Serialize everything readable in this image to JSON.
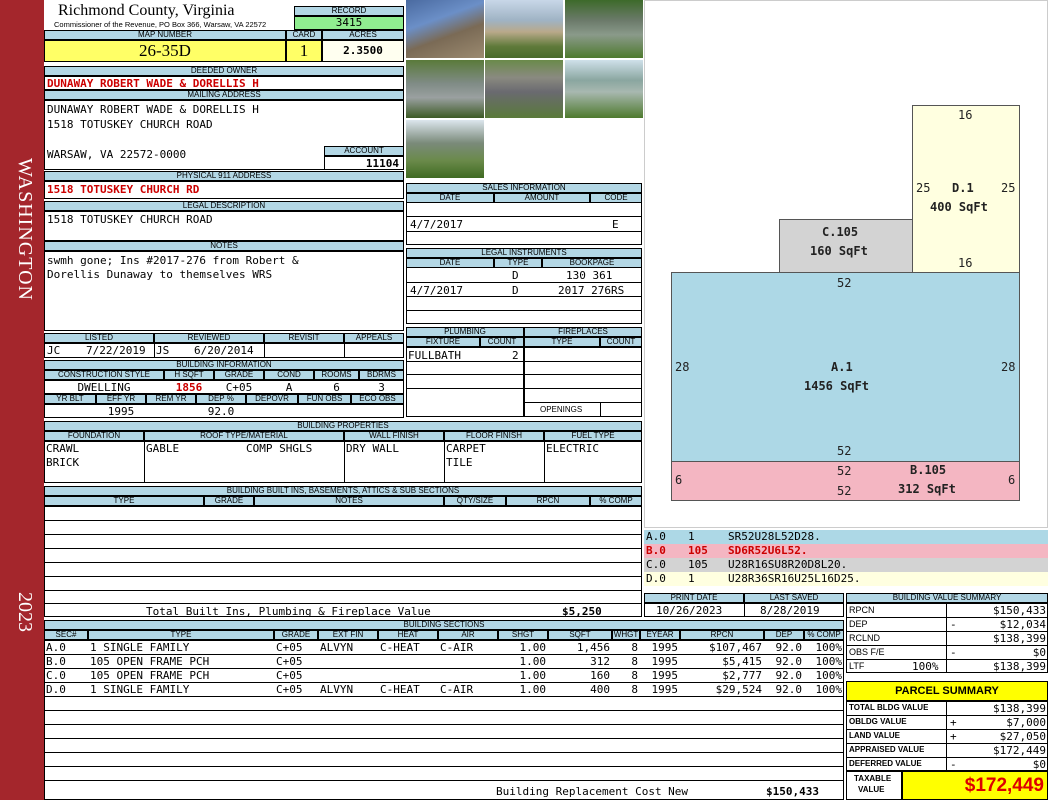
{
  "sidebar": {
    "top_text": "WASHINGTON",
    "bottom_text": "2023",
    "color": "#a4262c"
  },
  "header": {
    "county": "Richmond County, Virginia",
    "commissioner": "Commissioner of the Revenue, PO Box 366, Warsaw, VA 22572",
    "record_label": "RECORD",
    "record": "3415",
    "map_label": "MAP NUMBER",
    "map": "26-35D",
    "card_label": "CARD",
    "card": "1",
    "acres_label": "ACRES",
    "acres": "2.3500"
  },
  "owner": {
    "label": "DEEDED OWNER",
    "name": "DUNAWAY ROBERT WADE & DORELLIS H",
    "mailing_label": "MAILING ADDRESS",
    "mail1": "DUNAWAY ROBERT WADE & DORELLIS H",
    "mail2": "1518 TOTUSKEY CHURCH ROAD",
    "mail3": "WARSAW, VA 22572-0000",
    "account_label": "ACCOUNT",
    "account": "11104",
    "phys_label": "PHYSICAL 911 ADDRESS",
    "phys": "1518 TOTUSKEY CHURCH RD",
    "legal_label": "LEGAL DESCRIPTION",
    "legal": "1518 TOTUSKEY CHURCH ROAD",
    "notes_label": "NOTES",
    "notes1": "swmh gone; Ins #2017-276 from Robert &",
    "notes2": "Dorellis Dunaway to themselves WRS"
  },
  "sales": {
    "label": "SALES INFORMATION",
    "h_date": "DATE",
    "h_amount": "AMOUNT",
    "h_code": "CODE",
    "date": "4/7/2017",
    "code": "E"
  },
  "legal_inst": {
    "label": "LEGAL INSTRUMENTS",
    "h_date": "DATE",
    "h_type": "TYPE",
    "h_book": "BOOKPAGE",
    "rows": [
      {
        "date": "",
        "type": "D",
        "book": "130 361"
      },
      {
        "date": "4/7/2017",
        "type": "D",
        "book": "2017 276RS"
      }
    ]
  },
  "listed": {
    "h_listed": "LISTED",
    "h_reviewed": "REVIEWED",
    "h_revisit": "REVISIT",
    "h_appeals": "APPEALS",
    "listed_by": "JC",
    "listed_date": "7/22/2019",
    "rev_by": "JS",
    "rev_date": "6/20/2014"
  },
  "plumbing": {
    "label": "PLUMBING",
    "h_fixture": "FIXTURE",
    "h_count": "COUNT",
    "fixture": "FULLBATH",
    "count": "2",
    "fire_label": "FIREPLACES",
    "h_ftype": "TYPE",
    "h_fcount": "COUNT",
    "openings": "OPENINGS"
  },
  "building_info": {
    "label": "BUILDING INFORMATION",
    "h_style": "CONSTRUCTION STYLE",
    "h_hsqft": "H SQFT",
    "h_grade": "GRADE",
    "h_cond": "COND",
    "h_rooms": "ROOMS",
    "h_bdrms": "BDRMS",
    "style": "DWELLING",
    "hsqft": "1856",
    "grade": "C+05",
    "cond": "A",
    "rooms": "6",
    "bdrms": "3",
    "h_yrblt": "YR BLT",
    "h_effyr": "EFF YR",
    "h_remyr": "REM YR",
    "h_dep": "DEP %",
    "h_depovr": "DEPOVR",
    "h_funobs": "FUN OBS",
    "h_ecoobs": "ECO OBS",
    "effyr": "1995",
    "dep": "92.0"
  },
  "building_props": {
    "label": "BUILDING PROPERTIES",
    "h_found": "FOUNDATION",
    "h_roof": "ROOF TYPE/MATERIAL",
    "h_wall": "WALL FINISH",
    "h_floor": "FLOOR FINISH",
    "h_fuel": "FUEL TYPE",
    "found1": "CRAWL",
    "found2": "BRICK",
    "roof1": "GABLE",
    "roof2": "COMP SHGLS",
    "wall": "DRY WALL",
    "floor1": "CARPET",
    "floor2": "TILE",
    "fuel": "ELECTRIC"
  },
  "builtins": {
    "label": "BUILDING BUILT INS, BASEMENTS, ATTICS & SUB SECTIONS",
    "h_type": "TYPE",
    "h_grade": "GRADE",
    "h_notes": "NOTES",
    "h_qty": "QTY/SIZE",
    "h_rpcn": "RPCN",
    "h_comp": "% COMP",
    "total_label": "Total Built Ins, Plumbing & Fireplace Value",
    "total": "$5,250"
  },
  "print": {
    "h_print": "PRINT DATE",
    "h_saved": "LAST SAVED",
    "print_date": "10/26/2023",
    "saved": "8/28/2019"
  },
  "sketch": {
    "d": {
      "name": "D.1",
      "area": "400 SqFt",
      "top": "16",
      "left": "25",
      "right": "25",
      "bottom": "16"
    },
    "c": {
      "name": "C.105",
      "area": "160 SqFt"
    },
    "a": {
      "name": "A.1",
      "area": "1456 SqFt",
      "top": "52",
      "left": "28",
      "right": "28",
      "bottom": "52"
    },
    "b": {
      "name": "B.105",
      "area": "312 SqFt",
      "top": "52",
      "left": "6",
      "right": "6",
      "bottom": "52"
    },
    "colors": {
      "a": "#add8e6",
      "b": "#f4b6c2",
      "c": "#d3d3d3",
      "d": "#ffffe0"
    }
  },
  "codes": [
    {
      "id": "A.0",
      "n": "1",
      "code": "SR52U28L52D28."
    },
    {
      "id": "B.0",
      "n": "105",
      "code": "SD6R52U6L52."
    },
    {
      "id": "C.0",
      "n": "105",
      "code": "U28R16SU8R20D8L20."
    },
    {
      "id": "D.0",
      "n": "1",
      "code": "U28R36SR16U25L16D25."
    }
  ],
  "value_summary": {
    "label": "BUILDING VALUE SUMMARY",
    "rpcn_l": "RPCN",
    "rpcn": "$150,433",
    "dep_l": "DEP",
    "dep_s": "-",
    "dep": "$12,034",
    "rclnd_l": "RCLND",
    "rclnd": "$138,399",
    "obs_l": "OBS F/E",
    "obs_s": "-",
    "obs": "$0",
    "ltf_l": "LTF",
    "ltf_p": "100%",
    "ltf": "$138,399"
  },
  "parcel": {
    "label": "PARCEL SUMMARY",
    "tb_l": "TOTAL BLDG VALUE",
    "tb": "$138,399",
    "ob_l": "OBLDG VALUE",
    "ob_s": "+",
    "ob": "$7,000",
    "lv_l": "LAND VALUE",
    "lv_s": "+",
    "lv": "$27,050",
    "av_l": "APPRAISED VALUE",
    "av": "$172,449",
    "dv_l": "DEFERRED VALUE",
    "dv_s": "-",
    "dv": "$0",
    "tx_l1": "TAXABLE",
    "tx_l2": "VALUE",
    "tx": "$172,449"
  },
  "sections": {
    "label": "BUILDING SECTIONS",
    "headers": [
      "SEC#",
      "TYPE",
      "GRADE",
      "EXT FIN",
      "HEAT",
      "AIR",
      "SHGT",
      "SQFT",
      "WHGT",
      "EYEAR",
      "RPCN",
      "DEP",
      "% COMP"
    ],
    "rows": [
      {
        "sec": "A.0",
        "type": "1 SINGLE FAMILY",
        "grade": "C+05",
        "ext": "ALVYN",
        "heat": "C-HEAT",
        "air": "C-AIR",
        "shgt": "1.00",
        "sqft": "1,456",
        "whgt": "8",
        "eyear": "1995",
        "rpcn": "$107,467",
        "dep": "92.0",
        "comp": "100%"
      },
      {
        "sec": "B.0",
        "type": "105 OPEN FRAME PCH",
        "grade": "C+05",
        "ext": "",
        "heat": "",
        "air": "",
        "shgt": "1.00",
        "sqft": "312",
        "whgt": "8",
        "eyear": "1995",
        "rpcn": "$5,415",
        "dep": "92.0",
        "comp": "100%"
      },
      {
        "sec": "C.0",
        "type": "105 OPEN FRAME PCH",
        "grade": "C+05",
        "ext": "",
        "heat": "",
        "air": "",
        "shgt": "1.00",
        "sqft": "160",
        "whgt": "8",
        "eyear": "1995",
        "rpcn": "$2,777",
        "dep": "92.0",
        "comp": "100%"
      },
      {
        "sec": "D.0",
        "type": "1 SINGLE FAMILY",
        "grade": "C+05",
        "ext": "ALVYN",
        "heat": "C-HEAT",
        "air": "C-AIR",
        "shgt": "1.00",
        "sqft": "400",
        "whgt": "8",
        "eyear": "1995",
        "rpcn": "$29,524",
        "dep": "92.0",
        "comp": "100%"
      }
    ],
    "total_label": "Building Replacement Cost New",
    "total": "$150,433"
  }
}
